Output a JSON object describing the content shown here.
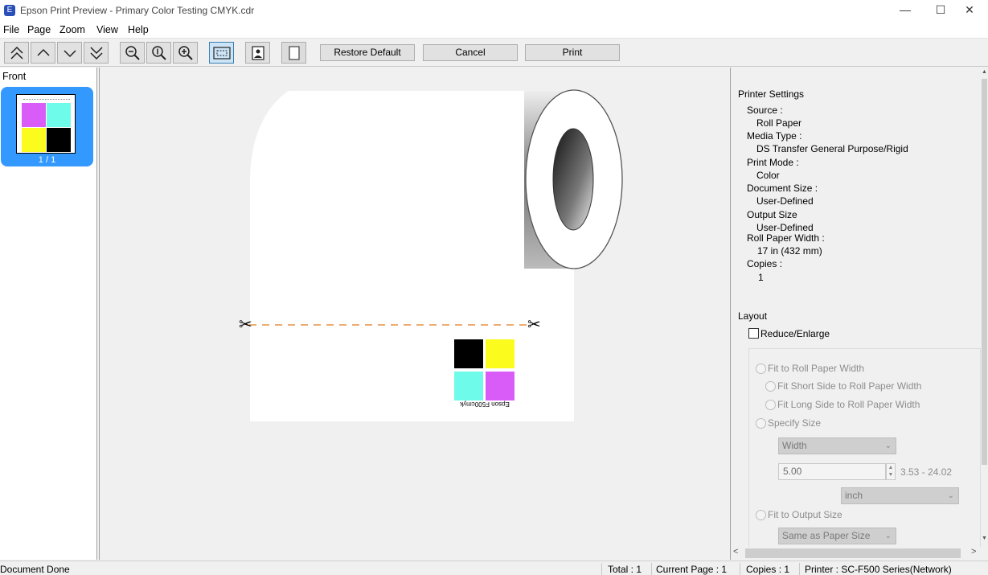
{
  "window": {
    "title": "Epson Print Preview - Primary Color Testing CMYK.cdr",
    "app_icon": "epson-app-icon"
  },
  "menu": [
    "File",
    "Page",
    "Zoom",
    "View",
    "Help"
  ],
  "toolbar": {
    "restore_label": "Restore Default",
    "cancel_label": "Cancel",
    "print_label": "Print"
  },
  "thumbnails": {
    "heading": "Front",
    "page_indicator": "1 / 1"
  },
  "preview": {
    "print_label": "Epson F500cmyk",
    "swatch_colors": [
      "#000000",
      "#fbfb1e",
      "#6ffbe9",
      "#da5cf8"
    ],
    "cut_line_color": "#e07a1f"
  },
  "printer_settings": {
    "heading": "Printer Settings",
    "source_label": "Source :",
    "source_value": "Roll Paper",
    "media_type_label": "Media Type :",
    "media_type_value": "DS Transfer General Purpose/Rigid",
    "print_mode_label": "Print Mode :",
    "print_mode_value": "Color",
    "document_size_label": "Document Size :",
    "document_size_value": "User-Defined",
    "output_size_label": "Output Size",
    "output_size_value": "User-Defined",
    "roll_width_label": "Roll Paper Width :",
    "roll_width_value": "17 in (432 mm)",
    "copies_label": "Copies :",
    "copies_value": "1"
  },
  "layout": {
    "heading": "Layout",
    "reduce_enlarge_label": "Reduce/Enlarge",
    "reduce_enlarge_checked": false,
    "fit_roll_width": "Fit to Roll Paper Width",
    "fit_short_side": "Fit Short Side to Roll Paper Width",
    "fit_long_side": "Fit Long Side to Roll Paper Width",
    "specify_size": "Specify Size",
    "dimension_select": "Width",
    "size_value": "5.00",
    "size_range": "3.53 - 24.02",
    "unit_select": "inch",
    "fit_output_size": "Fit to Output Size",
    "output_select": "Same as Paper Size"
  },
  "status": {
    "message": "Document Done",
    "total": "Total : 1",
    "current_page": "Current Page : 1",
    "copies": "Copies : 1",
    "printer": "Printer : SC-F500 Series(Network)"
  }
}
